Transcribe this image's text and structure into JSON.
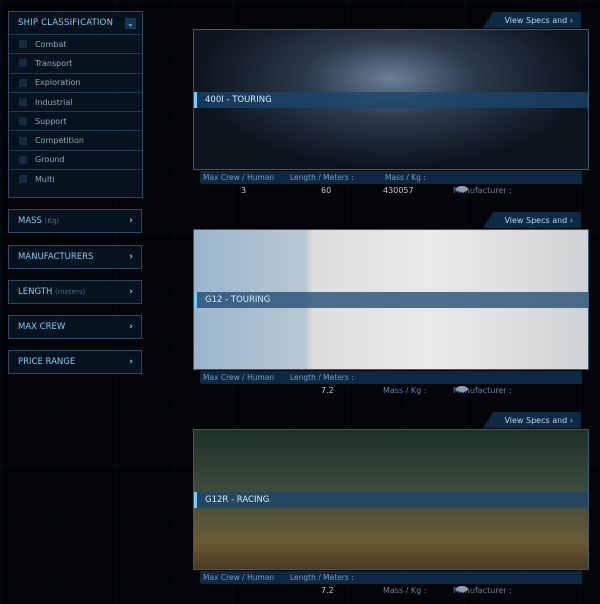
{
  "sidebar": {
    "classification": {
      "title": "SHIP CLASSIFICATION",
      "items": [
        "Combat",
        "Transport",
        "Exploration",
        "Industrial",
        "Support",
        "Competition",
        "Ground",
        "Multi"
      ]
    },
    "filters": [
      {
        "label": "MASS",
        "sub": "(Kg)"
      },
      {
        "label": "MANUFACTURERS",
        "sub": ""
      },
      {
        "label": "LENGTH",
        "sub": "(meters)"
      },
      {
        "label": "MAX CREW",
        "sub": ""
      },
      {
        "label": "PRICE RANGE",
        "sub": ""
      }
    ]
  },
  "labels": {
    "view_specs": "View Specs and",
    "max_crew": "Max Crew / Human",
    "length": "Length / Meters :",
    "mass": "Mass / Kg :",
    "manufacturer": "Manufacturer :"
  },
  "ships": [
    {
      "name": "400I - TOURING",
      "crew": "3",
      "length": "60",
      "mass": "430057"
    },
    {
      "name": "G12 - TOURING",
      "crew": "",
      "length": "7.2",
      "mass": ""
    },
    {
      "name": "G12R - RACING",
      "crew": "",
      "length": "7.2",
      "mass": ""
    }
  ],
  "colors": {
    "accent": "#7fcdf0",
    "background": "#020407"
  }
}
